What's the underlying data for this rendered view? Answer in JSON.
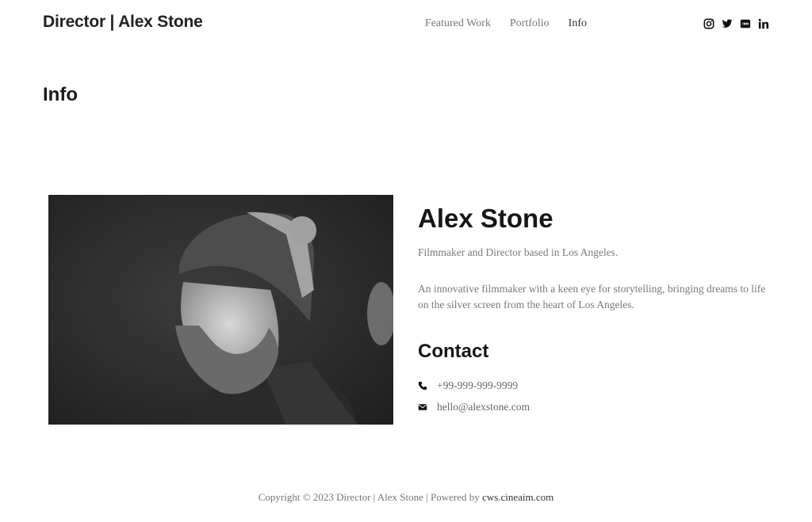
{
  "header": {
    "brand": "Director | Alex Stone",
    "nav": [
      {
        "label": "Featured Work",
        "active": false
      },
      {
        "label": "Portfolio",
        "active": false
      },
      {
        "label": "Info",
        "active": true
      }
    ],
    "socials": [
      {
        "name": "instagram-icon",
        "label": "Instagram"
      },
      {
        "name": "twitter-icon",
        "label": "Twitter"
      },
      {
        "name": "imdb-icon",
        "label": "IMDb"
      },
      {
        "name": "linkedin-icon",
        "label": "LinkedIn"
      }
    ]
  },
  "page": {
    "title": "Info"
  },
  "profile": {
    "image_alt": "Black and white portrait of a bearded man wearing a knit beanie",
    "name": "Alex Stone",
    "tagline": "Filmmaker and Director based in Los Angeles.",
    "description": "An innovative filmmaker with a keen eye for storytelling, bringing dreams to life on the silver screen from the heart of Los Angeles.",
    "contact_heading": "Contact",
    "phone": "+99-999-999-9999",
    "email": "hello@alexstone.com"
  },
  "footer": {
    "text": "Copyright © 2023 Director | Alex Stone | Powered by ",
    "link_label": "cws.cineaim.com"
  }
}
